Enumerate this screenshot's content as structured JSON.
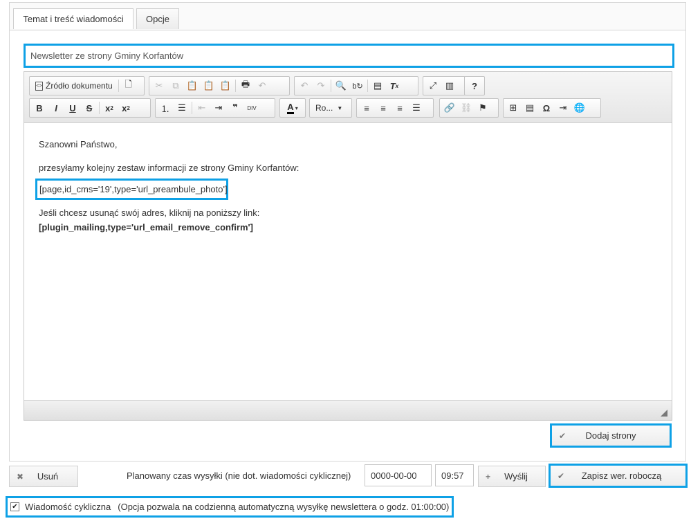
{
  "tabs": [
    {
      "label": "Temat i treść wiadomości"
    },
    {
      "label": "Opcje"
    }
  ],
  "subject": {
    "value": "Newsletter ze strony Gminy Korfantów"
  },
  "toolbar": {
    "source_label": "Źródło dokumentu",
    "font_combo": "Ro..."
  },
  "content": {
    "greeting": "Szanowni Państwo,",
    "intro": "przesyłamy kolejny zestaw informacji ze strony Gminy Korfantów:",
    "preamble_tag": "[page,id_cms='19',type='url_preambule_photo']",
    "remove_text": "Jeśli chcesz usunąć swój adres, kliknij na poniższy link:",
    "remove_tag": "[plugin_mailing,type='url_email_remove_confirm']"
  },
  "buttons": {
    "add_pages": "Dodaj strony",
    "delete": "Usuń",
    "send": "Wyślij",
    "save_draft": "Zapisz wer. roboczą"
  },
  "schedule": {
    "label": "Planowany czas wysyłki (nie dot. wiadomości cyklicznej)",
    "date": "0000-00-00",
    "time": "09:57"
  },
  "cyclic": {
    "checked": true,
    "label": "Wiadomość cykliczna",
    "hint": "(Opcja pozwala na codzienną automatyczną wysyłkę newslettera o godz. 01:00:00)"
  },
  "colors": {
    "highlight": "#0ea1e6"
  }
}
